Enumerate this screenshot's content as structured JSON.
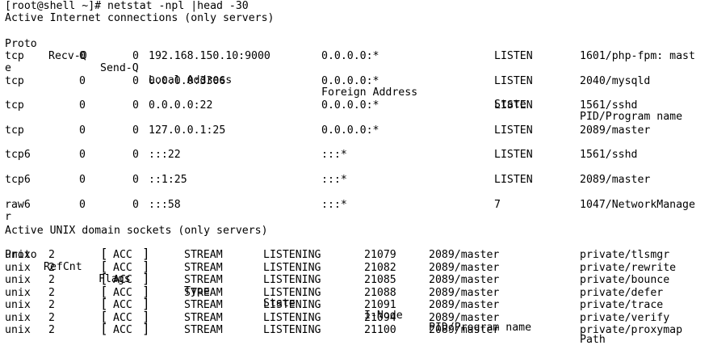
{
  "prompt": "[root@shell ~]# netstat -npl |head -30",
  "inet": {
    "title": "Active Internet connections (only servers)",
    "headers": [
      "Proto",
      "Recv-Q",
      "Send-Q",
      "Local Address",
      "Foreign Address",
      "State",
      "PID/Program name"
    ],
    "rows": [
      {
        "proto": "tcp",
        "recv": "0",
        "send": "0",
        "local": "192.168.150.10:9000",
        "foreign": "0.0.0.0:*",
        "state": "LISTEN",
        "pid": "1601/php-fpm: mast",
        "wrap": "e"
      },
      {
        "proto": "tcp",
        "recv": "0",
        "send": "0",
        "local": "0.0.0.0:3306",
        "foreign": "0.0.0.0:*",
        "state": "LISTEN",
        "pid": "2040/mysqld"
      },
      {
        "proto": "tcp",
        "recv": "0",
        "send": "0",
        "local": "0.0.0.0:22",
        "foreign": "0.0.0.0:*",
        "state": "LISTEN",
        "pid": "1561/sshd"
      },
      {
        "proto": "tcp",
        "recv": "0",
        "send": "0",
        "local": "127.0.0.1:25",
        "foreign": "0.0.0.0:*",
        "state": "LISTEN",
        "pid": "2089/master"
      },
      {
        "proto": "tcp6",
        "recv": "0",
        "send": "0",
        "local": ":::22",
        "foreign": ":::*",
        "state": "LISTEN",
        "pid": "1561/sshd"
      },
      {
        "proto": "tcp6",
        "recv": "0",
        "send": "0",
        "local": "::1:25",
        "foreign": ":::*",
        "state": "LISTEN",
        "pid": "2089/master"
      },
      {
        "proto": "raw6",
        "recv": "0",
        "send": "0",
        "local": ":::58",
        "foreign": ":::*",
        "state": "7",
        "pid": "1047/NetworkManage",
        "wrap": "r"
      }
    ]
  },
  "unix": {
    "title": "Active UNIX domain sockets (only servers)",
    "headers": [
      "Proto",
      "RefCnt",
      "Flags",
      "Type",
      "State",
      "I-Node",
      "PID/Program name",
      "Path"
    ],
    "rows": [
      {
        "proto": "unix",
        "ref": "2",
        "flags": "ACC",
        "type": "STREAM",
        "state": "LISTENING",
        "inode": "21079",
        "pid": "2089/master",
        "path": "private/tlsmgr"
      },
      {
        "proto": "unix",
        "ref": "2",
        "flags": "ACC",
        "type": "STREAM",
        "state": "LISTENING",
        "inode": "21082",
        "pid": "2089/master",
        "path": "private/rewrite"
      },
      {
        "proto": "unix",
        "ref": "2",
        "flags": "ACC",
        "type": "STREAM",
        "state": "LISTENING",
        "inode": "21085",
        "pid": "2089/master",
        "path": "private/bounce"
      },
      {
        "proto": "unix",
        "ref": "2",
        "flags": "ACC",
        "type": "STREAM",
        "state": "LISTENING",
        "inode": "21088",
        "pid": "2089/master",
        "path": "private/defer"
      },
      {
        "proto": "unix",
        "ref": "2",
        "flags": "ACC",
        "type": "STREAM",
        "state": "LISTENING",
        "inode": "21091",
        "pid": "2089/master",
        "path": "private/trace"
      },
      {
        "proto": "unix",
        "ref": "2",
        "flags": "ACC",
        "type": "STREAM",
        "state": "LISTENING",
        "inode": "21094",
        "pid": "2089/master",
        "path": "private/verify"
      },
      {
        "proto": "unix",
        "ref": "2",
        "flags": "ACC",
        "type": "STREAM",
        "state": "LISTENING",
        "inode": "21100",
        "pid": "2089/master",
        "path": "private/proxymap"
      }
    ]
  }
}
